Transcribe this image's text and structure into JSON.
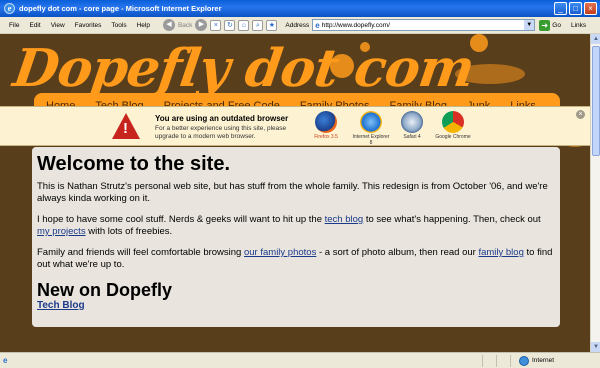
{
  "window": {
    "title": "dopefly dot com - core page - Microsoft Internet Explorer",
    "minimize": "_",
    "maximize": "□",
    "close": "×"
  },
  "menu": [
    "File",
    "Edit",
    "View",
    "Favorites",
    "Tools",
    "Help"
  ],
  "toolbar": {
    "back_label": "Back",
    "address_label": "Address",
    "url": "http://www.dopefly.com/",
    "go_label": "Go",
    "links_label": "Links"
  },
  "site": {
    "logo": "Dopefly dot com",
    "nav": [
      "Home",
      "Tech Blog",
      "Projects and Free Code",
      "Family Photos",
      "Family Blog",
      "Junk",
      "Links"
    ]
  },
  "banner": {
    "title": "You are using an outdated browser",
    "subtitle": "For a better experience using this site, please upgrade to a modern web browser.",
    "browsers": [
      "Firefox 3.5",
      "Internet Explorer 8",
      "Safari 4",
      "Google Chrome"
    ]
  },
  "content": {
    "heading": "Welcome to the site.",
    "p1": "This is Nathan Strutz's personal web site, but has stuff from the whole family. This redesign is from October '06, and we're always kinda working on it.",
    "p2_a": "I hope to have some cool stuff. Nerds & geeks will want to hit up the ",
    "p2_link1": "tech blog",
    "p2_b": " to see what's happening. Then, check out ",
    "p2_link2": "my projects",
    "p2_c": " with lots of freebies.",
    "p3_a": "Family and friends will feel comfortable browsing ",
    "p3_link1": "our family photos",
    "p3_b": " - a sort of photo album, then read our ",
    "p3_link2": "family blog",
    "p3_c": " to find out what we're up to.",
    "heading2": "New on Dopefly",
    "sub_link": "Tech Blog"
  },
  "status": {
    "zone": "Internet"
  },
  "colors": {
    "page_bg": "#593e1c",
    "accent": "#ff9a1a",
    "banner_bg": "#fdf2d2",
    "content_bg": "#e9e5de",
    "link": "#1b3a8a"
  }
}
